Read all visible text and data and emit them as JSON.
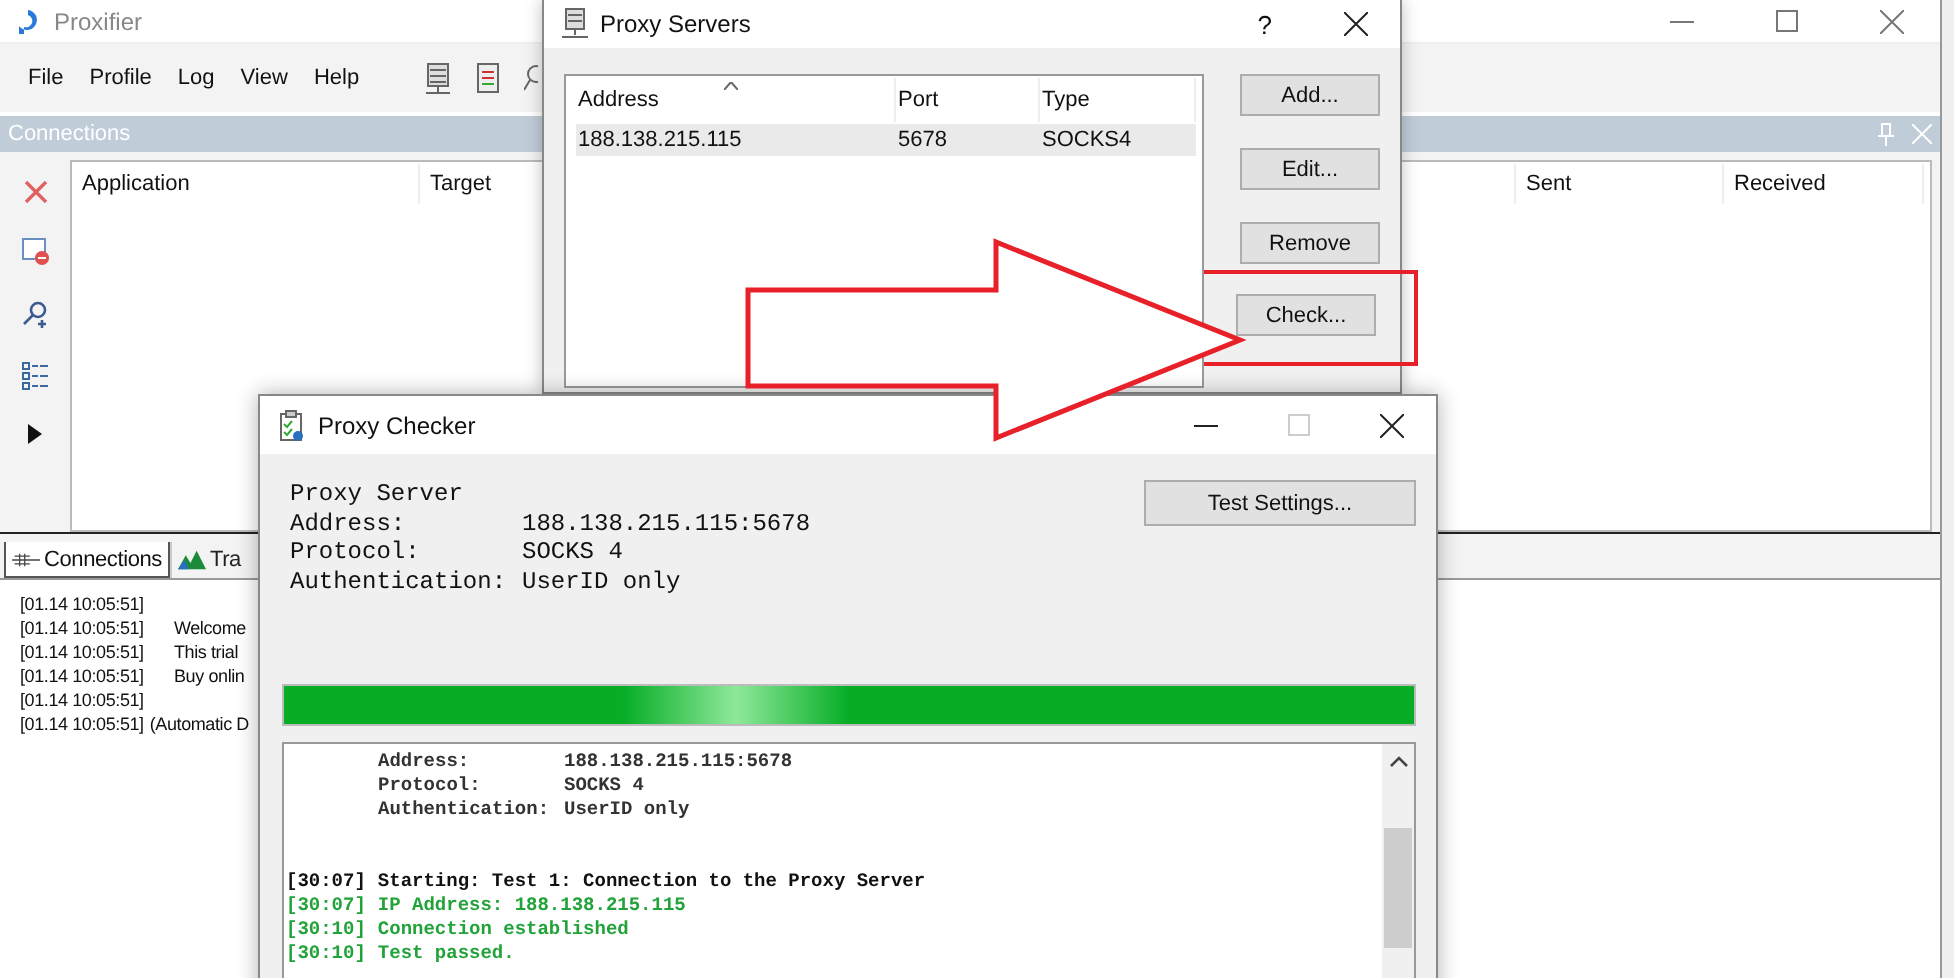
{
  "main_window": {
    "title": "Proxifier",
    "menu": [
      "File",
      "Profile",
      "Log",
      "View",
      "Help"
    ],
    "connections_panel": {
      "title": "Connections",
      "columns": [
        {
          "label": "Application"
        },
        {
          "label": "Target"
        },
        {
          "label": "Sent"
        },
        {
          "label": "Received"
        }
      ]
    },
    "tabs": [
      {
        "label": "Connections",
        "selected": true
      },
      {
        "label": "Tra",
        "selected": false
      }
    ],
    "log": [
      {
        "time": "[01.14 10:05:51]"
      },
      {
        "time": "[01.14 10:05:51]",
        "message": "Welcome"
      },
      {
        "time": "[01.14 10:05:51]",
        "message": "This trial"
      },
      {
        "time": "[01.14 10:05:51]",
        "message": "Buy onlin"
      },
      {
        "time": "[01.14 10:05:51]"
      },
      {
        "time": "[01.14 10:05:51]",
        "message": "(Automatic D"
      }
    ]
  },
  "proxy_servers_dialog": {
    "title": "Proxy Servers",
    "help": "?",
    "columns": [
      "Address",
      "Port",
      "Type"
    ],
    "rows": [
      {
        "address": "188.138.215.115",
        "port": "5678",
        "type": "SOCKS4",
        "selected": true
      }
    ],
    "buttons": [
      {
        "label": "Add...",
        "highlighted": false
      },
      {
        "label": "Edit...",
        "highlighted": false
      },
      {
        "label": "Remove",
        "highlighted": false
      },
      {
        "label": "Check...",
        "highlighted": true
      }
    ]
  },
  "proxy_checker": {
    "title": "Proxy Checker",
    "heading": "Proxy Server",
    "info": [
      {
        "label": "Address:",
        "value": "188.138.215.115:5678"
      },
      {
        "label": "Protocol:",
        "value": "SOCKS 4"
      },
      {
        "label": "Authentication:",
        "value": "UserID only"
      }
    ],
    "test_settings_button": "Test Settings...",
    "progress": {
      "level": 1
    },
    "log": [
      {
        "kind": "detail",
        "label": "Address:",
        "value": "188.138.215.115:5678"
      },
      {
        "kind": "detail",
        "label": "Protocol:",
        "value": "SOCKS 4"
      },
      {
        "kind": "detail",
        "label": "Authentication:",
        "value": "UserID only"
      },
      {
        "kind": "gap"
      },
      {
        "kind": "step",
        "time": "[30:07]",
        "text": "Starting: Test 1: Connection to the Proxy Server"
      },
      {
        "kind": "success",
        "time": "[30:07]",
        "text": "IP Address: 188.138.215.115"
      },
      {
        "kind": "success",
        "time": "[30:10]",
        "text": "Connection established"
      },
      {
        "kind": "success",
        "time": "[30:10]",
        "text": "Test passed."
      }
    ]
  }
}
